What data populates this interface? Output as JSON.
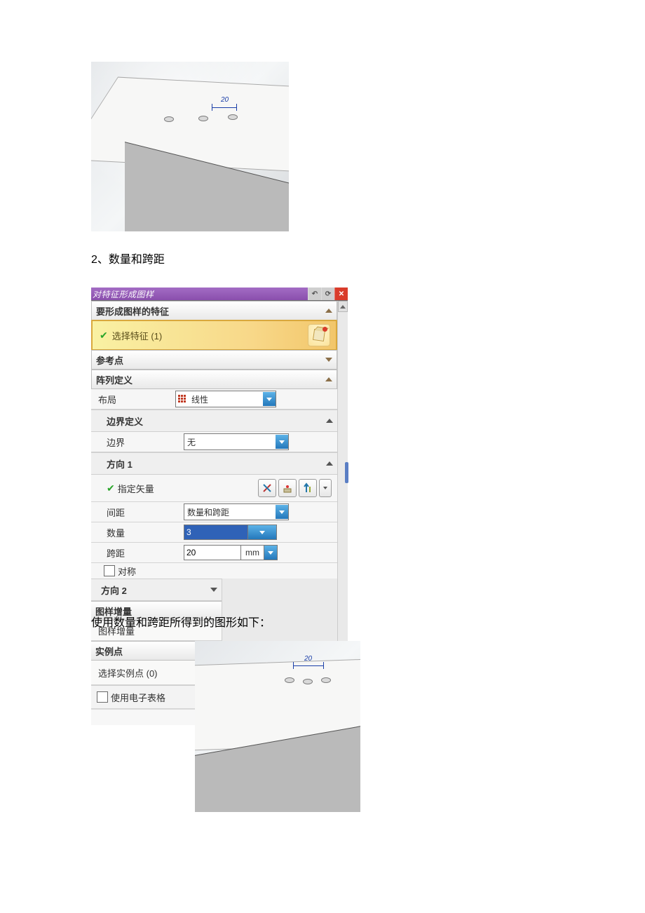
{
  "figure1": {
    "dim_label": "20"
  },
  "heading": "2、数量和跨距",
  "dialog": {
    "title": "对特征形成图样",
    "section_features": "要形成图样的特征",
    "select_feature": "选择特征 (1)",
    "ref_point": "参考点",
    "array_def": "阵列定义",
    "layout_label": "布局",
    "layout_value": "线性",
    "boundary_def": "边界定义",
    "boundary_label": "边界",
    "boundary_value": "无",
    "dir1": "方向 1",
    "vector_label": "指定矢量",
    "spacing_label": "间距",
    "spacing_value": "数量和跨距",
    "count_label": "数量",
    "count_value": "3",
    "span_label": "跨距",
    "span_value": "20",
    "span_unit": "mm",
    "symmetric": "对称",
    "dir2": "方向 2",
    "pattern_inc_section": "图样增量",
    "pattern_inc_label": "图样增量",
    "instance_pts_section": "实例点",
    "select_instance": "选择实例点 (0)",
    "use_spreadsheet": "使用电子表格"
  },
  "overlay_caption": "使用数量和跨距所得到的图形如下：",
  "figure2": {
    "dim_label": "20"
  }
}
